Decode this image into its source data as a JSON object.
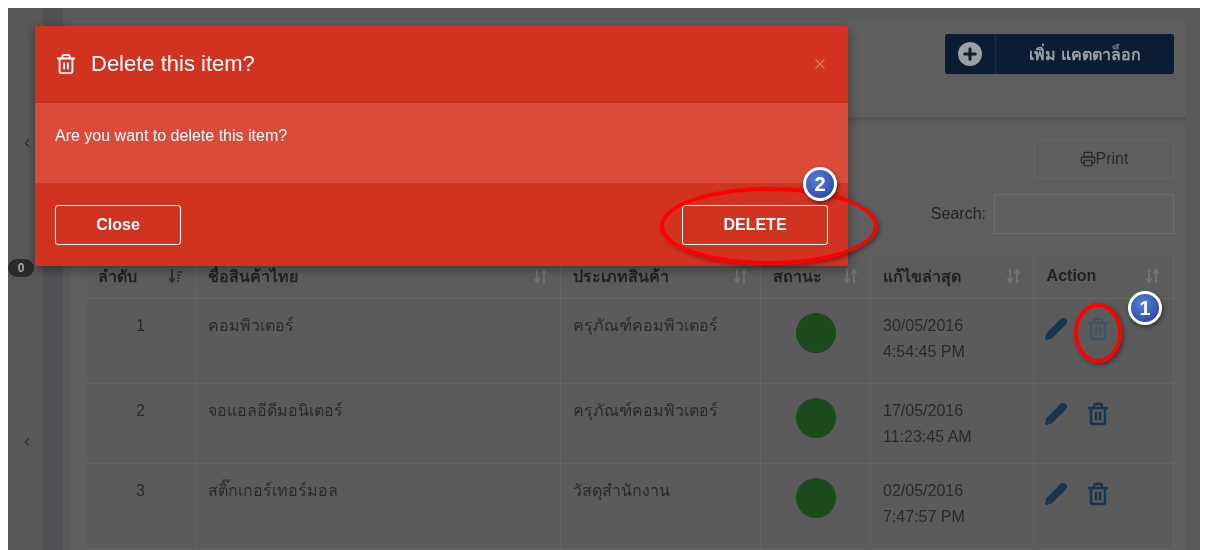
{
  "sidebar": {
    "badge": "0"
  },
  "add_button": {
    "label": "เพิ่ม แคตตาล็อก"
  },
  "print_button": {
    "label": "Print"
  },
  "search": {
    "label": "Search:"
  },
  "table": {
    "columns": [
      {
        "label": "ลำดับ",
        "sorted": true
      },
      {
        "label": "ชื่อสินค้าไทย",
        "sorted": false
      },
      {
        "label": "ประเภทสินค้า",
        "sorted": false
      },
      {
        "label": "สถานะ",
        "sorted": false
      },
      {
        "label": "แก้ไขล่าสุด",
        "sorted": false
      },
      {
        "label": "Action",
        "sorted": false
      }
    ],
    "rows": [
      {
        "no": "1",
        "name": "คอมพิวเตอร์",
        "category": "ครุภัณฑ์คอมพิวเตอร์",
        "color": "#1b4a1c",
        "date": "30/05/2016",
        "time": "4:54:45 PM",
        "delete_hovered": true
      },
      {
        "no": "2",
        "name": "จอแอลอีดีมอนิเตอร์",
        "category": "ครุภัณฑ์คอมพิวเตอร์",
        "color": "#1b4a1c",
        "date": "17/05/2016",
        "time": "11:23:45 AM",
        "delete_hovered": false
      },
      {
        "no": "3",
        "name": "สติ๊กเกอร์เทอร์มอล",
        "category": "วัสดุสำนักงาน",
        "color": "#1b4a1c",
        "date": "02/05/2016",
        "time": "7:47:57 PM",
        "delete_hovered": false
      }
    ]
  },
  "dialog": {
    "title": "Delete this item?",
    "message": "Are you want to delete this item?",
    "buttons": [
      {
        "label": "Close",
        "kind": "close"
      },
      {
        "label": "DELETE",
        "kind": "delete"
      }
    ]
  },
  "annotations": [
    {
      "number": "1"
    },
    {
      "number": "2"
    }
  ]
}
